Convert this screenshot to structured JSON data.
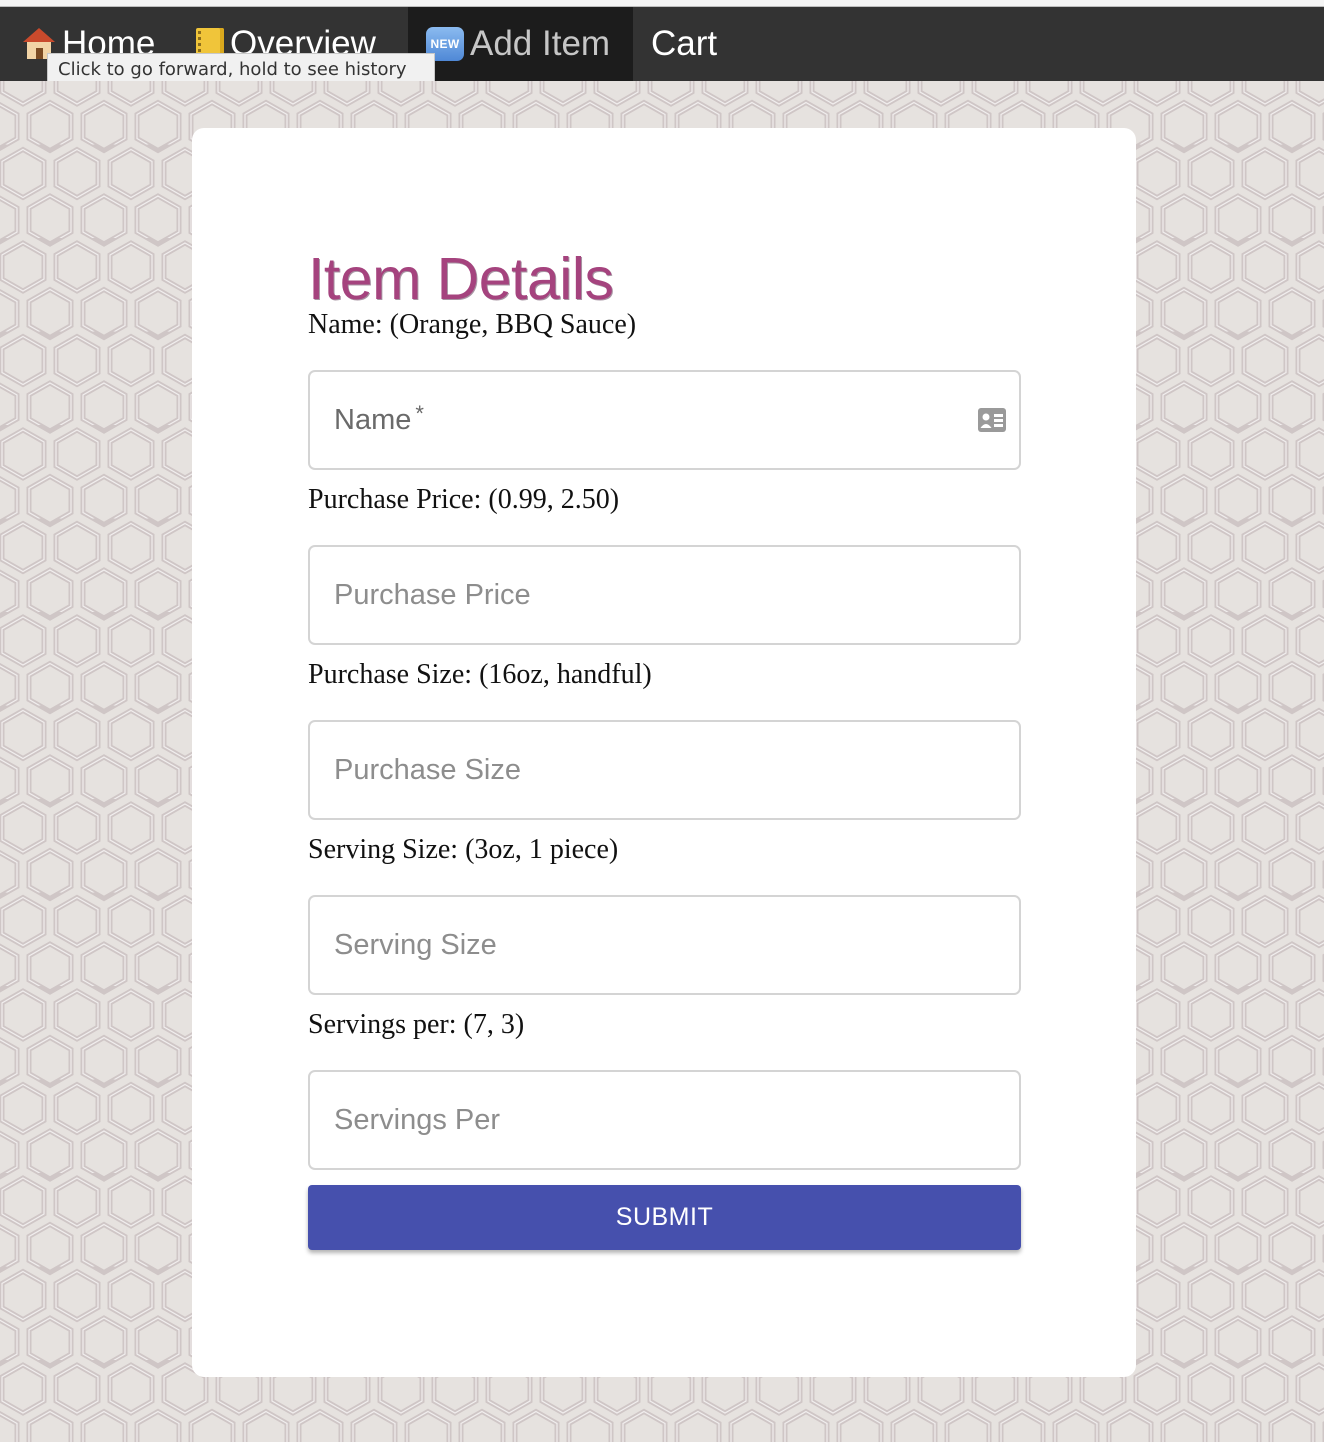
{
  "nav": {
    "items": [
      {
        "label": "Home",
        "icon": "house-icon"
      },
      {
        "label": "Overview",
        "icon": "notebook-icon"
      },
      {
        "label": "Add Item",
        "icon": "new-badge-icon",
        "badge": "NEW",
        "active": true
      },
      {
        "label": "Cart"
      }
    ]
  },
  "tooltip": "Click to go forward, hold to see history",
  "form": {
    "title": "Item Details",
    "fields": [
      {
        "hint": "Name: (Orange, BBQ Sauce)",
        "placeholder": "Name",
        "required_mark": "*",
        "value": ""
      },
      {
        "hint": "Purchase Price: (0.99, 2.50)",
        "placeholder": "Purchase Price",
        "value": ""
      },
      {
        "hint": "Purchase Size: (16oz, handful)",
        "placeholder": "Purchase Size",
        "value": ""
      },
      {
        "hint": "Serving Size: (3oz, 1 piece)",
        "placeholder": "Serving Size",
        "value": ""
      },
      {
        "hint": "Servings per: (7, 3)",
        "placeholder": "Servings Per",
        "value": ""
      }
    ],
    "submit_label": "SUBMIT"
  },
  "colors": {
    "navbar": "#333333",
    "title": "#a5437e",
    "submit": "#4650ad",
    "background": "#e6e2df"
  }
}
